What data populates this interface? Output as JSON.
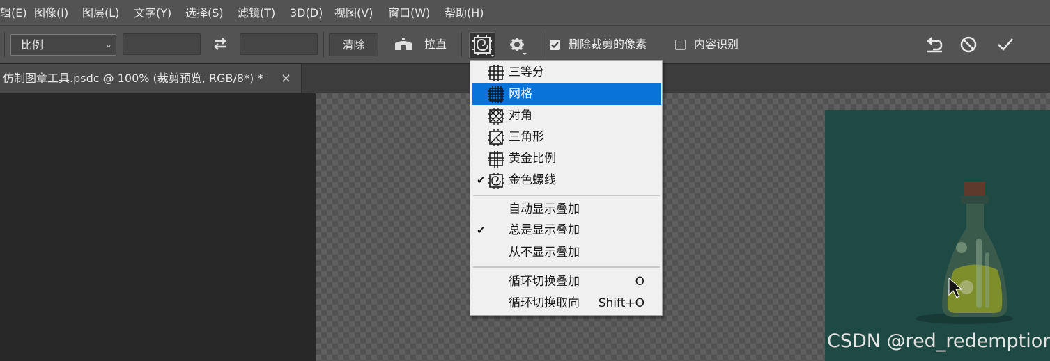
{
  "menubar": {
    "items": [
      "辑(E)",
      "图像(I)",
      "图层(L)",
      "文字(Y)",
      "选择(S)",
      "滤镜(T)",
      "3D(D)",
      "视图(V)",
      "窗口(W)",
      "帮助(H)"
    ]
  },
  "options": {
    "ratio_select": "比例",
    "clear_button": "清除",
    "straighten_label": "拉直",
    "delete_cropped_label": "删除裁剪的像素",
    "delete_cropped_checked": true,
    "content_aware_label": "内容识别",
    "content_aware_checked": false
  },
  "document_tab": {
    "title": "仿制图章工具.psdc @ 100% (裁剪预览, RGB/8*) *",
    "close": "×"
  },
  "overlay_menu": {
    "overlays": [
      {
        "label": "三等分",
        "icon": "thirds-grid-icon",
        "checked": false,
        "highlighted": false
      },
      {
        "label": "网格",
        "icon": "grid-icon",
        "checked": false,
        "highlighted": true
      },
      {
        "label": "对角",
        "icon": "diagonal-icon",
        "checked": false,
        "highlighted": false
      },
      {
        "label": "三角形",
        "icon": "triangle-icon",
        "checked": false,
        "highlighted": false
      },
      {
        "label": "黄金比例",
        "icon": "golden-ratio-icon",
        "checked": false,
        "highlighted": false
      },
      {
        "label": "金色螺线",
        "icon": "golden-spiral-icon",
        "checked": true,
        "highlighted": false
      }
    ],
    "display_modes": [
      {
        "label": "自动显示叠加",
        "checked": false
      },
      {
        "label": "总是显示叠加",
        "checked": true
      },
      {
        "label": "从不显示叠加",
        "checked": false
      }
    ],
    "cycle_items": [
      {
        "label": "循环切换叠加",
        "shortcut": "O"
      },
      {
        "label": "循环切换取向",
        "shortcut": "Shift+O"
      }
    ]
  },
  "canvas": {
    "artboard_color": "#1f4a44",
    "highlight_color": "#0a73d9",
    "watermark": "CSDN @red_redemption"
  }
}
